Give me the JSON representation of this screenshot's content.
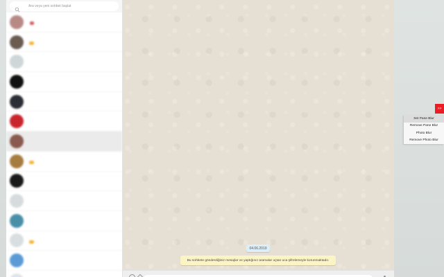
{
  "search": {
    "placeholder": "Ara veya yeni sohbet başlat",
    "icon": "search-icon"
  },
  "chats": [
    {
      "name": "",
      "preview": "",
      "time": "",
      "avatar_color": "#b88a86",
      "selected": false,
      "chip": "red"
    },
    {
      "name": "",
      "preview": "",
      "time": "",
      "avatar_color": "#6b5c52",
      "selected": false,
      "chip": "emoji"
    },
    {
      "name": "",
      "preview": "",
      "time": "",
      "avatar_color": "#cfd6d8",
      "selected": false,
      "chip": ""
    },
    {
      "name": "",
      "preview": "",
      "time": "",
      "avatar_color": "#111111",
      "selected": false,
      "chip": ""
    },
    {
      "name": "",
      "preview": "",
      "time": "",
      "avatar_color": "#2b2e35",
      "selected": false,
      "chip": ""
    },
    {
      "name": "",
      "preview": "",
      "time": "",
      "avatar_color": "#c9252f",
      "selected": false,
      "chip": ""
    },
    {
      "name": "",
      "preview": "",
      "time": "",
      "avatar_color": "#8a5a4e",
      "selected": true,
      "chip": ""
    },
    {
      "name": "",
      "preview": "",
      "time": "",
      "avatar_color": "#a67c3f",
      "selected": false,
      "chip": "emoji"
    },
    {
      "name": "",
      "preview": "",
      "time": "",
      "avatar_color": "#1a1a1a",
      "selected": false,
      "chip": ""
    },
    {
      "name": "",
      "preview": "",
      "time": "",
      "avatar_color": "#d6dcde",
      "selected": false,
      "chip": ""
    },
    {
      "name": "",
      "preview": "",
      "time": "",
      "avatar_color": "#4a8fa8",
      "selected": false,
      "chip": ""
    },
    {
      "name": "",
      "preview": "",
      "time": "",
      "avatar_color": "#d9dfe1",
      "selected": false,
      "chip": "emoji"
    },
    {
      "name": "",
      "preview": "",
      "time": "",
      "avatar_color": "#5b9bd5",
      "selected": false,
      "chip": ""
    },
    {
      "name": "",
      "preview": "",
      "time": "",
      "avatar_color": "#dfe4e6",
      "selected": false,
      "chip": ""
    }
  ],
  "conversation": {
    "date": "04.06.2019",
    "encryption_notice": "Bu sohbete gönderdiğiniz mesajlar ve yaptığınız aramalar uçtan uca şifrelemeyle korunmaktadır."
  },
  "extension": {
    "toggle_label": ">>",
    "toggle_color": "#ec1c24",
    "menu": [
      {
        "label": "Set Pane Blur",
        "active": true
      },
      {
        "label": "Remove Pane Blur",
        "active": false
      },
      {
        "label": "Photo Blur",
        "active": false
      },
      {
        "label": "Remove Photo Blur",
        "active": false
      }
    ]
  }
}
